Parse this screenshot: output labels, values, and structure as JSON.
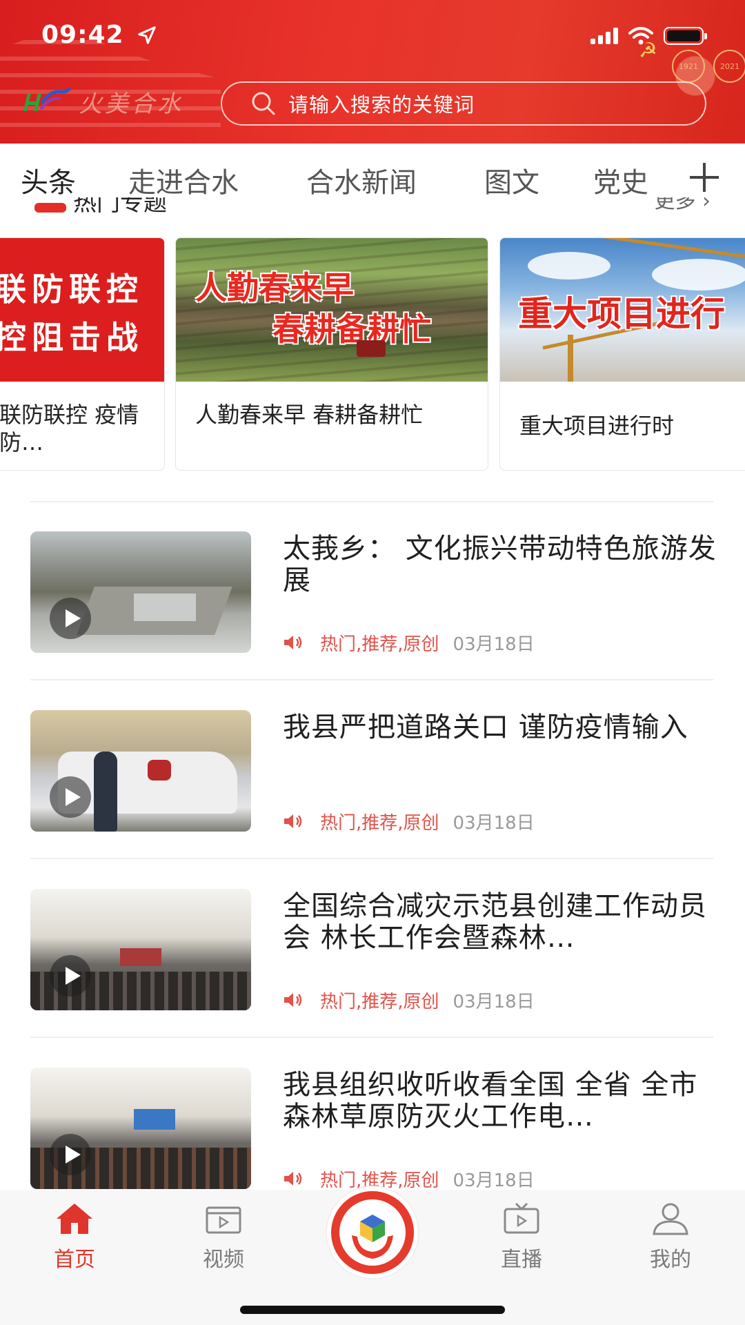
{
  "status_bar": {
    "time": "09:42"
  },
  "header": {
    "logo_text": "火美合水",
    "search_placeholder": "请输入搜索的关键词",
    "badge_years": [
      "1921",
      "2021"
    ]
  },
  "tabs": [
    {
      "label": "头条",
      "active": true
    },
    {
      "label": "走进合水",
      "active": false
    },
    {
      "label": "合水新闻",
      "active": false
    },
    {
      "label": "图文",
      "active": false
    },
    {
      "label": "党史",
      "active": false
    }
  ],
  "hot_topics": {
    "title": "热门专题",
    "more_label": "更多 ›",
    "cards": [
      {
        "image_text": [
          "联防联控",
          "疫情防控阻击战"
        ],
        "title": "联防联控 疫情防…"
      },
      {
        "image_text": [
          "人勤春来早",
          "春耕备耕忙"
        ],
        "title": "人勤春来早 春耕备耕忙"
      },
      {
        "image_text": [
          "重大项目进行"
        ],
        "title": "重大项目进行时"
      }
    ]
  },
  "news": [
    {
      "title": "太莪乡： 文化振兴带动特色旅游发展",
      "tags": "热门,推荐,原创",
      "date": "03月18日",
      "has_video": true
    },
    {
      "title": "我县严把道路关口 谨防疫情输入",
      "tags": "热门,推荐,原创",
      "date": "03月18日",
      "has_video": true
    },
    {
      "title": "全国综合减灾示范县创建工作动员会 林长工作会暨森林…",
      "tags": "热门,推荐,原创",
      "date": "03月18日",
      "has_video": true
    },
    {
      "title": "我县组织收听收看全国 全省 全市森林草原防灭火工作电…",
      "tags": "热门,推荐,原创",
      "date": "03月18日",
      "has_video": true
    }
  ],
  "bottom_nav": [
    {
      "label": "首页",
      "icon": "home-icon",
      "active": true
    },
    {
      "label": "视频",
      "icon": "video-icon",
      "active": false
    },
    {
      "label": "直播",
      "icon": "live-tv-icon",
      "active": false
    },
    {
      "label": "我的",
      "icon": "profile-icon",
      "active": false
    }
  ],
  "colors": {
    "brand_red": "#e32f27",
    "tag_red": "#e0524a",
    "date_gray": "#999999"
  }
}
